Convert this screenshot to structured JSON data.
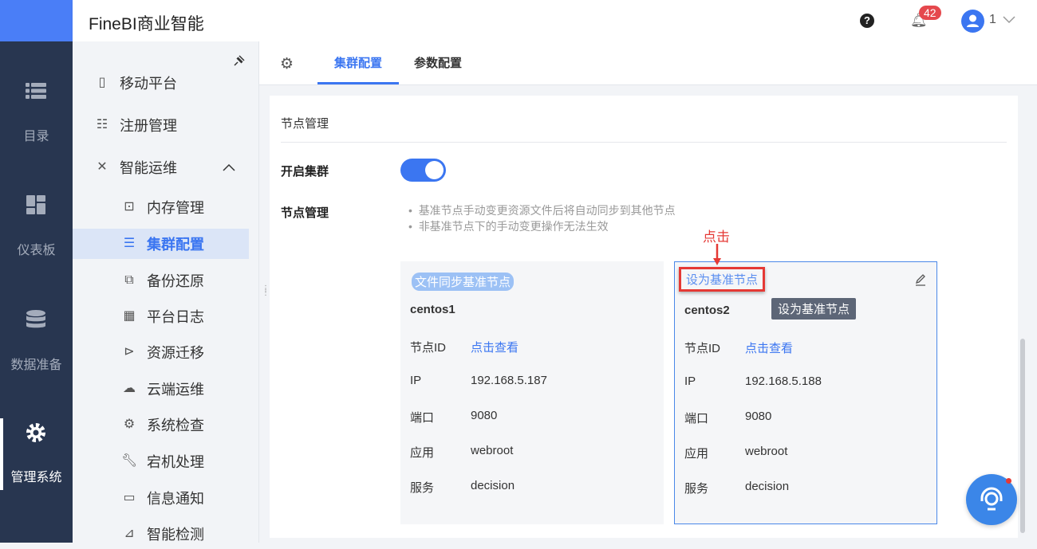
{
  "header": {
    "app_title": "FineBI商业智能",
    "notification_count": "42",
    "user_name": "1"
  },
  "rail": [
    {
      "label": "目录",
      "icon": "list-icon"
    },
    {
      "label": "仪表板",
      "icon": "dashboard-icon"
    },
    {
      "label": "数据准备",
      "icon": "database-icon"
    },
    {
      "label": "管理系统",
      "icon": "gear-icon",
      "active": true
    }
  ],
  "sidebar": {
    "top": [
      {
        "label": "移动平台"
      },
      {
        "label": "注册管理"
      },
      {
        "label": "智能运维"
      }
    ],
    "sub": [
      {
        "label": "内存管理"
      },
      {
        "label": "集群配置",
        "active": true
      },
      {
        "label": "备份还原"
      },
      {
        "label": "平台日志"
      },
      {
        "label": "资源迁移"
      },
      {
        "label": "云端运维"
      },
      {
        "label": "系统检查"
      },
      {
        "label": "宕机处理"
      },
      {
        "label": "信息通知"
      },
      {
        "label": "智能检测"
      }
    ]
  },
  "tabs": [
    {
      "label": "集群配置",
      "active": true
    },
    {
      "label": "参数配置"
    }
  ],
  "main": {
    "section_title": "节点管理",
    "enable_cluster_label": "开启集群",
    "enable_cluster": true,
    "node_mgmt_label": "节点管理",
    "tips": [
      "基准节点手动变更资源文件后将自动同步到其他节点",
      "非基准节点下的手动变更操作无法生效"
    ],
    "annotation": "点击",
    "tooltip": "设为基准节点",
    "row_labels": {
      "id": "节点ID",
      "ip": "IP",
      "port": "端口",
      "app": "应用",
      "service": "服务"
    },
    "nodes": [
      {
        "badge": "文件同步基准节点",
        "name": "centos1",
        "id_link": "点击查看",
        "ip": "192.168.5.187",
        "port": "9080",
        "app": "webroot",
        "service": "decision"
      },
      {
        "action": "设为基准节点",
        "name": "centos2",
        "id_link": "点击查看",
        "ip": "192.168.5.188",
        "port": "9080",
        "app": "webroot",
        "service": "decision"
      }
    ]
  }
}
